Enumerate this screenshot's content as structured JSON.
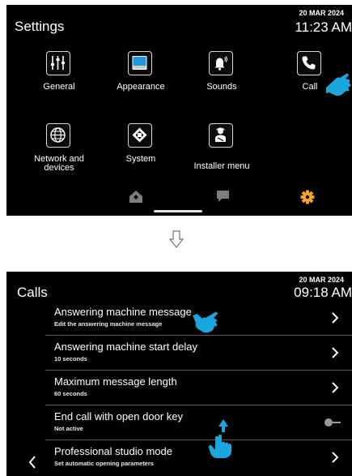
{
  "settings_screen": {
    "title": "Settings",
    "date": "20 MAR 2024",
    "time": "11:23 AM",
    "tiles": [
      {
        "label": "General",
        "icon": "sliders-icon"
      },
      {
        "label": "Appearance",
        "icon": "display-icon"
      },
      {
        "label": "Sounds",
        "icon": "bell-icon"
      },
      {
        "label": "Call",
        "icon": "phone-icon"
      },
      {
        "label": "Network and devices",
        "icon": "globe-icon"
      },
      {
        "label": "System",
        "icon": "chip-icon"
      },
      {
        "label": "Installer menu",
        "icon": "installer-icon"
      }
    ],
    "bottom_bar": [
      "home-icon",
      "message-icon",
      "gear-icon"
    ],
    "accent_color": "#f5a623",
    "pointer_color": "#1aa7e0"
  },
  "transition": {
    "icon": "down-arrow-icon"
  },
  "calls_screen": {
    "title": "Calls",
    "date": "20 MAR 2024",
    "time": "09:18 AM",
    "rows": [
      {
        "title": "Answering machine message",
        "subtitle": "Edit the answering machine message",
        "control": "chevron"
      },
      {
        "title": "Answering machine start delay",
        "subtitle": "10 seconds",
        "control": "chevron"
      },
      {
        "title": "Maximum message length",
        "subtitle": "60 seconds",
        "control": "chevron"
      },
      {
        "title": "End call with open door key",
        "subtitle": "Not active",
        "control": "toggle-off"
      },
      {
        "title": "Professional studio mode",
        "subtitle": "Set automatic opening parameters",
        "control": "chevron"
      }
    ]
  }
}
